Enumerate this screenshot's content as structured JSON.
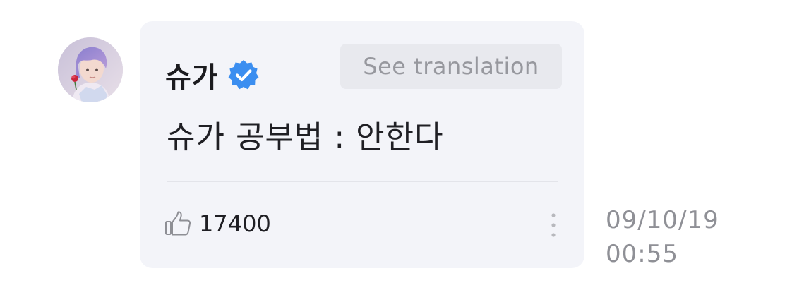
{
  "post": {
    "author": "슈가",
    "verified": true,
    "translate_label": "See translation",
    "message": "슈가 공부법 : 안한다",
    "likes": "17400",
    "timestamp_date": "09/10/19",
    "timestamp_time": "00:55"
  },
  "icons": {
    "verified": "verified-badge-icon",
    "like": "thumbs-up-icon",
    "more": "vertical-ellipsis-icon"
  },
  "colors": {
    "bubble_bg": "#f3f4f9",
    "verified_blue": "#3b8ef0",
    "button_bg": "#e8e9ee",
    "muted_text": "#8f9096",
    "primary_text": "#1f1f24"
  }
}
